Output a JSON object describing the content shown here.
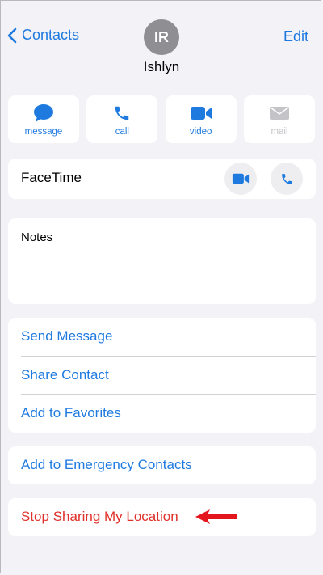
{
  "header": {
    "back_label": "Contacts",
    "edit_label": "Edit",
    "avatar_initials": "IR",
    "contact_name": "Ishlyn"
  },
  "actions": [
    {
      "label": "message",
      "icon": "message-icon",
      "enabled": true
    },
    {
      "label": "call",
      "icon": "phone-icon",
      "enabled": true
    },
    {
      "label": "video",
      "icon": "video-icon",
      "enabled": true
    },
    {
      "label": "mail",
      "icon": "mail-icon",
      "enabled": false
    }
  ],
  "facetime": {
    "label": "FaceTime"
  },
  "notes": {
    "label": "Notes"
  },
  "options": [
    "Send Message",
    "Share Contact",
    "Add to Favorites"
  ],
  "emergency": {
    "label": "Add to Emergency Contacts"
  },
  "stop_sharing": {
    "label": "Stop Sharing My Location"
  },
  "colors": {
    "accent": "#1f7ae0",
    "destructive": "#e0302a",
    "background": "#f2f2f7",
    "annotation_arrow": "#e3161e"
  }
}
